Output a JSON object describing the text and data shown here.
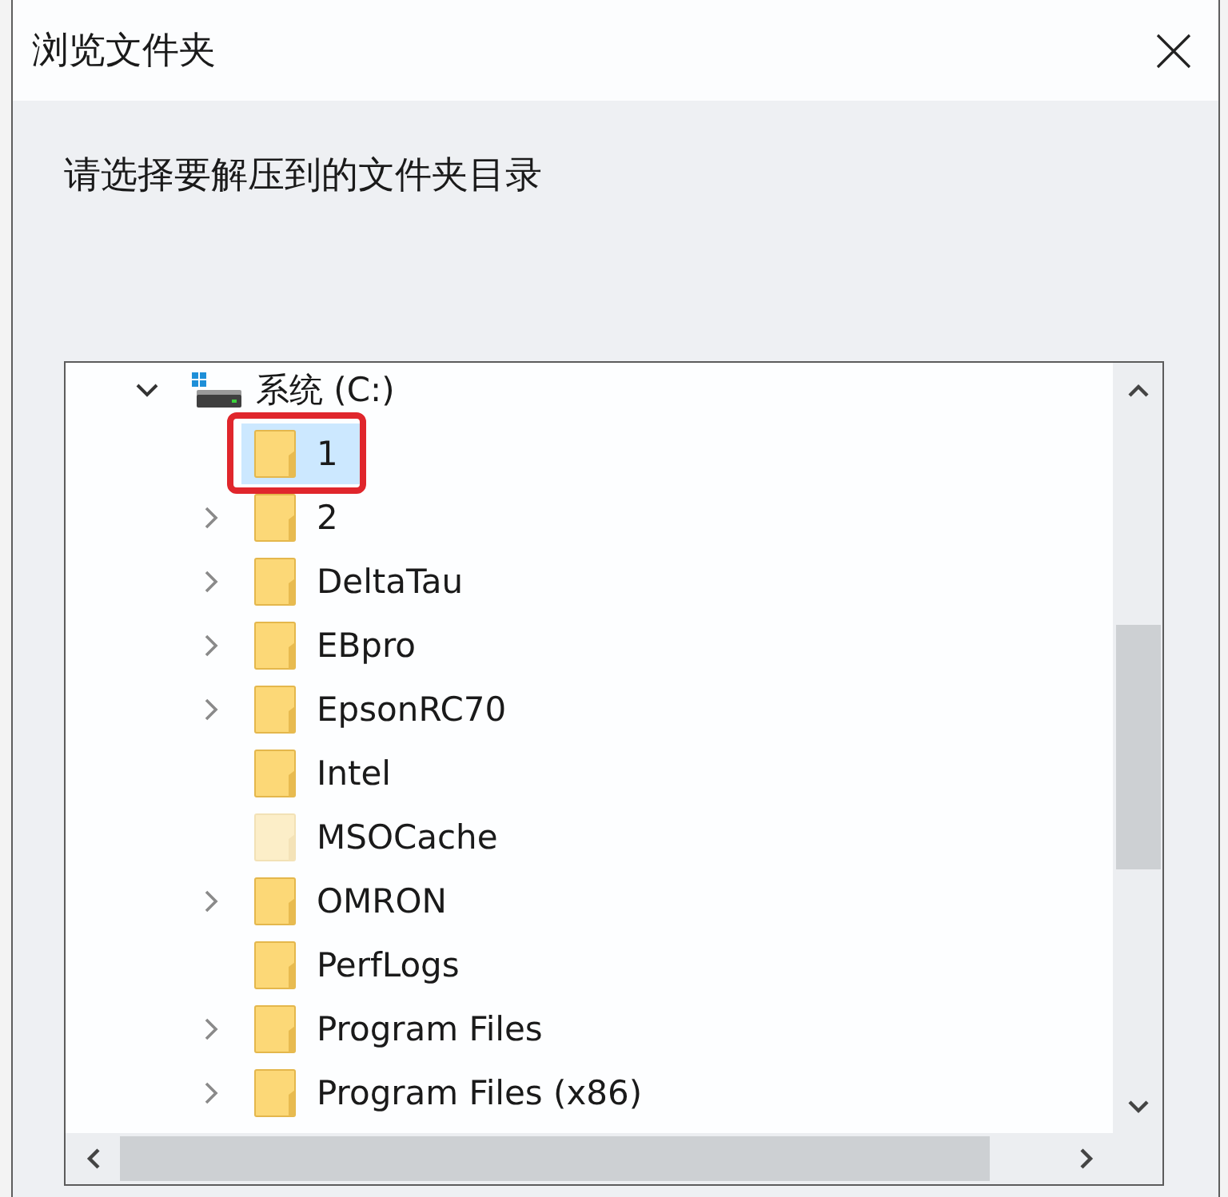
{
  "window": {
    "title": "浏览文件夹"
  },
  "instruction": "请选择要解压到的文件夹目录",
  "tree": {
    "items": [
      {
        "label": "系统 (C:)",
        "kind": "drive",
        "expandable": true,
        "expanded": true,
        "selected": false,
        "highlighted": false,
        "hidden": false,
        "children": [
          {
            "label": "1",
            "kind": "folder",
            "expandable": false,
            "selected": true,
            "highlighted": true,
            "hidden": false
          },
          {
            "label": "2",
            "kind": "folder",
            "expandable": true,
            "expanded": false,
            "selected": false,
            "highlighted": false,
            "hidden": false
          },
          {
            "label": "DeltaTau",
            "kind": "folder",
            "expandable": true,
            "expanded": false,
            "selected": false,
            "highlighted": false,
            "hidden": false
          },
          {
            "label": "EBpro",
            "kind": "folder",
            "expandable": true,
            "expanded": false,
            "selected": false,
            "highlighted": false,
            "hidden": false
          },
          {
            "label": "EpsonRC70",
            "kind": "folder",
            "expandable": true,
            "expanded": false,
            "selected": false,
            "highlighted": false,
            "hidden": false
          },
          {
            "label": "Intel",
            "kind": "folder",
            "expandable": false,
            "selected": false,
            "highlighted": false,
            "hidden": false
          },
          {
            "label": "MSOCache",
            "kind": "folder",
            "expandable": false,
            "selected": false,
            "highlighted": false,
            "hidden": true
          },
          {
            "label": "OMRON",
            "kind": "folder",
            "expandable": true,
            "expanded": false,
            "selected": false,
            "highlighted": false,
            "hidden": false
          },
          {
            "label": "PerfLogs",
            "kind": "folder",
            "expandable": false,
            "selected": false,
            "highlighted": false,
            "hidden": false
          },
          {
            "label": "Program Files",
            "kind": "folder",
            "expandable": true,
            "expanded": false,
            "selected": false,
            "highlighted": false,
            "hidden": false
          },
          {
            "label": "Program Files (x86)",
            "kind": "folder",
            "expandable": true,
            "expanded": false,
            "selected": false,
            "highlighted": false,
            "hidden": false
          }
        ]
      }
    ]
  }
}
